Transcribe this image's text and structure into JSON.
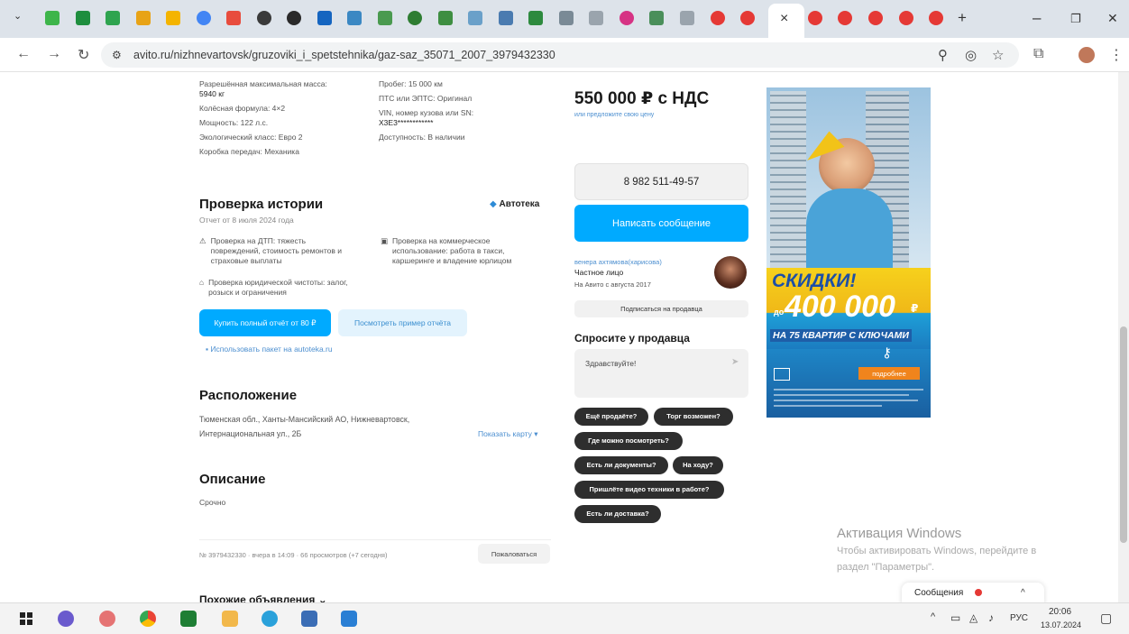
{
  "browser": {
    "active_tab_close": "×",
    "new_tab": "+",
    "url": "avito.ru/nizhnevartovsk/gruzoviki_i_spetstehnika/gaz-saz_35071_2007_3979432330",
    "window": {
      "minimize": "–",
      "restore": "❐",
      "close": "✕"
    },
    "nav": {
      "back": "←",
      "forward": "→",
      "reload": "↻"
    },
    "omni_icons": {
      "site_info": "⚙",
      "zoom": "⚲",
      "eye_off": "◎",
      "star": "☆",
      "ext": "⧉",
      "menu": "⋮"
    }
  },
  "specs": {
    "left": [
      "Разрешённая максимальная масса:",
      "5940 кг",
      "Колёсная формула: 4×2",
      "Мощность: 122 л.с.",
      "Экологический класс: Евро 2",
      "Коробка передач: Механика"
    ],
    "right": [
      "Пробег: 15 000 км",
      "ПТС или ЭПТС: Оригинал",
      "VIN, номер кузова или SN:",
      "X3E3************",
      "Доступность: В наличии"
    ]
  },
  "history": {
    "title": "Проверка истории",
    "brand": "Автотека",
    "date": "Отчет от 8 июля 2024 года",
    "items": [
      {
        "icon": "car-crash-icon",
        "text": "Проверка на ДТП: тяжесть повреждений, стоимость ремонтов и страховые выплаты"
      },
      {
        "icon": "taxi-icon",
        "text": "Проверка на коммерческое использование: работа в такси, каршеринге и владение юрлицом"
      },
      {
        "icon": "bank-icon",
        "text": "Проверка юридической чистоты: залог, розыск и ограничения"
      }
    ],
    "buy_button": "Купить полный отчёт от 80 ₽",
    "sample_button": "Посмотреть пример отчёта",
    "package_link": "Использовать пакет на autoteka.ru"
  },
  "location": {
    "title": "Расположение",
    "line1": "Тюменская обл., Ханты-Мансийский АО, Нижневартовск,",
    "line2": "Интернациональная ул., 2Б",
    "map_link": "Показать карту ▾"
  },
  "description": {
    "title": "Описание",
    "text": "Срочно"
  },
  "footer": {
    "meta": "№ 3979432330 · вчера в 14:09 · 66 просмотров (+7 сегодня)",
    "report_button": "Пожаловаться",
    "similar": "Похожие объявления ⌄"
  },
  "seller": {
    "price": "550 000 ₽ с НДС",
    "offer_link": "или предложите свою цену",
    "phone": "8 982 511-49-57",
    "message_button": "Написать сообщение",
    "name": "венера ахтямова(харисова)",
    "type": "Частное лицо",
    "since": "На Авито с августа 2017",
    "subscribe_button": "Подписаться на продавца",
    "ask_title": "Спросите у продавца",
    "ask_placeholder": "Здравствуйте!",
    "send_icon": "➤",
    "questions": [
      "Ещё продаёте?",
      "Торг возможен?",
      "Где можно посмотреть?",
      "Есть ли документы?",
      "На ходу?",
      "Пришлёте видео техники в работе?",
      "Есть ли доставка?"
    ]
  },
  "banner": {
    "headline": "СКИДКИ!",
    "upto": "до",
    "amount": "400 000",
    "currency": "₽",
    "tagline": "НА 75 КВАРТИР С КЛЮЧАМИ",
    "more_button": "подробнее"
  },
  "windows_activation": {
    "title": "Активация Windows",
    "text1": "Чтобы активировать Windows, перейдите в",
    "text2": "раздел \"Параметры\"."
  },
  "messages_widget": {
    "label": "Сообщения",
    "chevron": "^"
  },
  "taskbar": {
    "lang": "РУС",
    "time": "20:06",
    "date": "13.07.2024",
    "tray": "^"
  }
}
